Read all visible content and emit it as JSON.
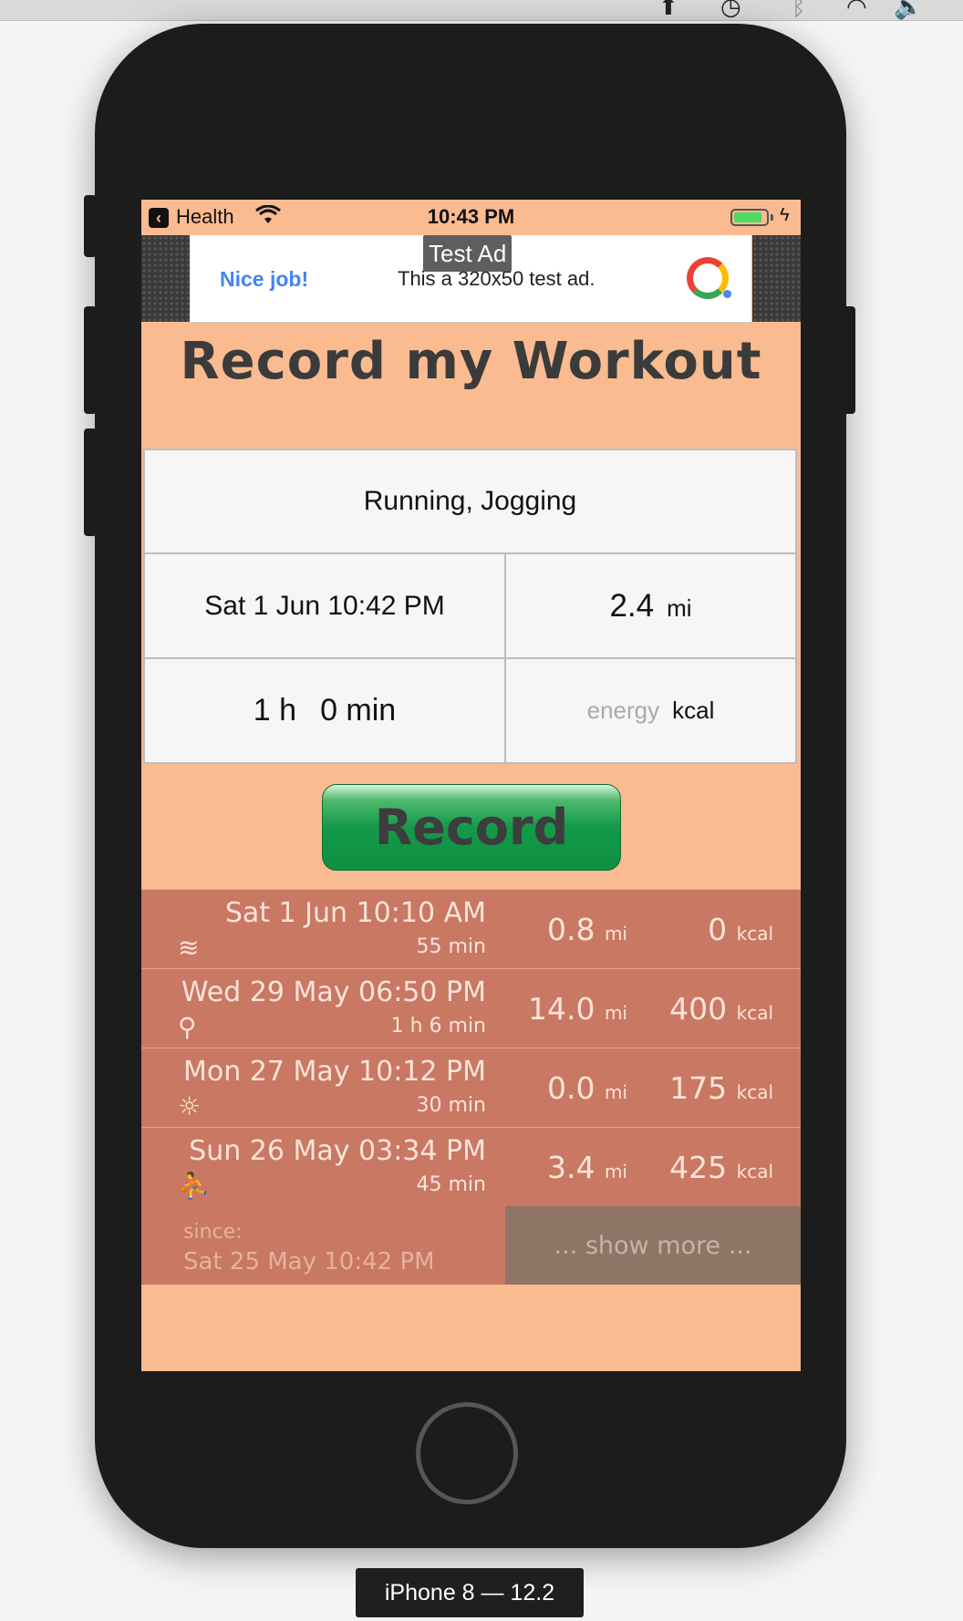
{
  "mac_status_icons": [
    "upload-icon",
    "time-machine-icon",
    "bluetooth-icon",
    "wifi-icon",
    "volume-icon"
  ],
  "statusbar": {
    "back_app": "Health",
    "time": "10:43 PM",
    "battery_color": "#4cd964"
  },
  "ad": {
    "tag": "Test Ad",
    "headline": "Nice job!",
    "text": "This a 320x50 test ad."
  },
  "title": "Record my Workout",
  "form": {
    "activity": "Running, Jogging",
    "datetime": "Sat 1 Jun 10:42 PM",
    "distance_value": "2.4",
    "distance_unit": "mi",
    "duration_hours": "1 h",
    "duration_minutes": "0 min",
    "energy_placeholder": "energy",
    "energy_unit": "kcal"
  },
  "record_label": "Record",
  "history": [
    {
      "date": "Sat 1 Jun 10:10 AM",
      "duration": "55 min",
      "icon": "swimming-icon",
      "distance": "0.8",
      "distance_unit": "mi",
      "energy": "0",
      "energy_unit": "kcal"
    },
    {
      "date": "Wed 29 May 06:50 PM",
      "duration": "1 h   6 min",
      "icon": "cycling-icon",
      "distance": "14.0",
      "distance_unit": "mi",
      "energy": "400",
      "energy_unit": "kcal"
    },
    {
      "date": "Mon 27 May 10:12 PM",
      "duration": "30 min",
      "icon": "sun-icon",
      "distance": "0.0",
      "distance_unit": "mi",
      "energy": "175",
      "energy_unit": "kcal"
    },
    {
      "date": "Sun 26 May 03:34 PM",
      "duration": "45 min",
      "icon": "running-icon",
      "distance": "3.4",
      "distance_unit": "mi",
      "energy": "425",
      "energy_unit": "kcal"
    }
  ],
  "since": {
    "label": "since:",
    "date": "Sat 25 May 10:42 PM"
  },
  "show_more": "... show more ...",
  "device_label": "iPhone 8 — 12.2",
  "colors": {
    "background": "#fabb91",
    "row": "#c97863",
    "record_green": "#139a49",
    "show_more_bg": "#8f7565"
  }
}
